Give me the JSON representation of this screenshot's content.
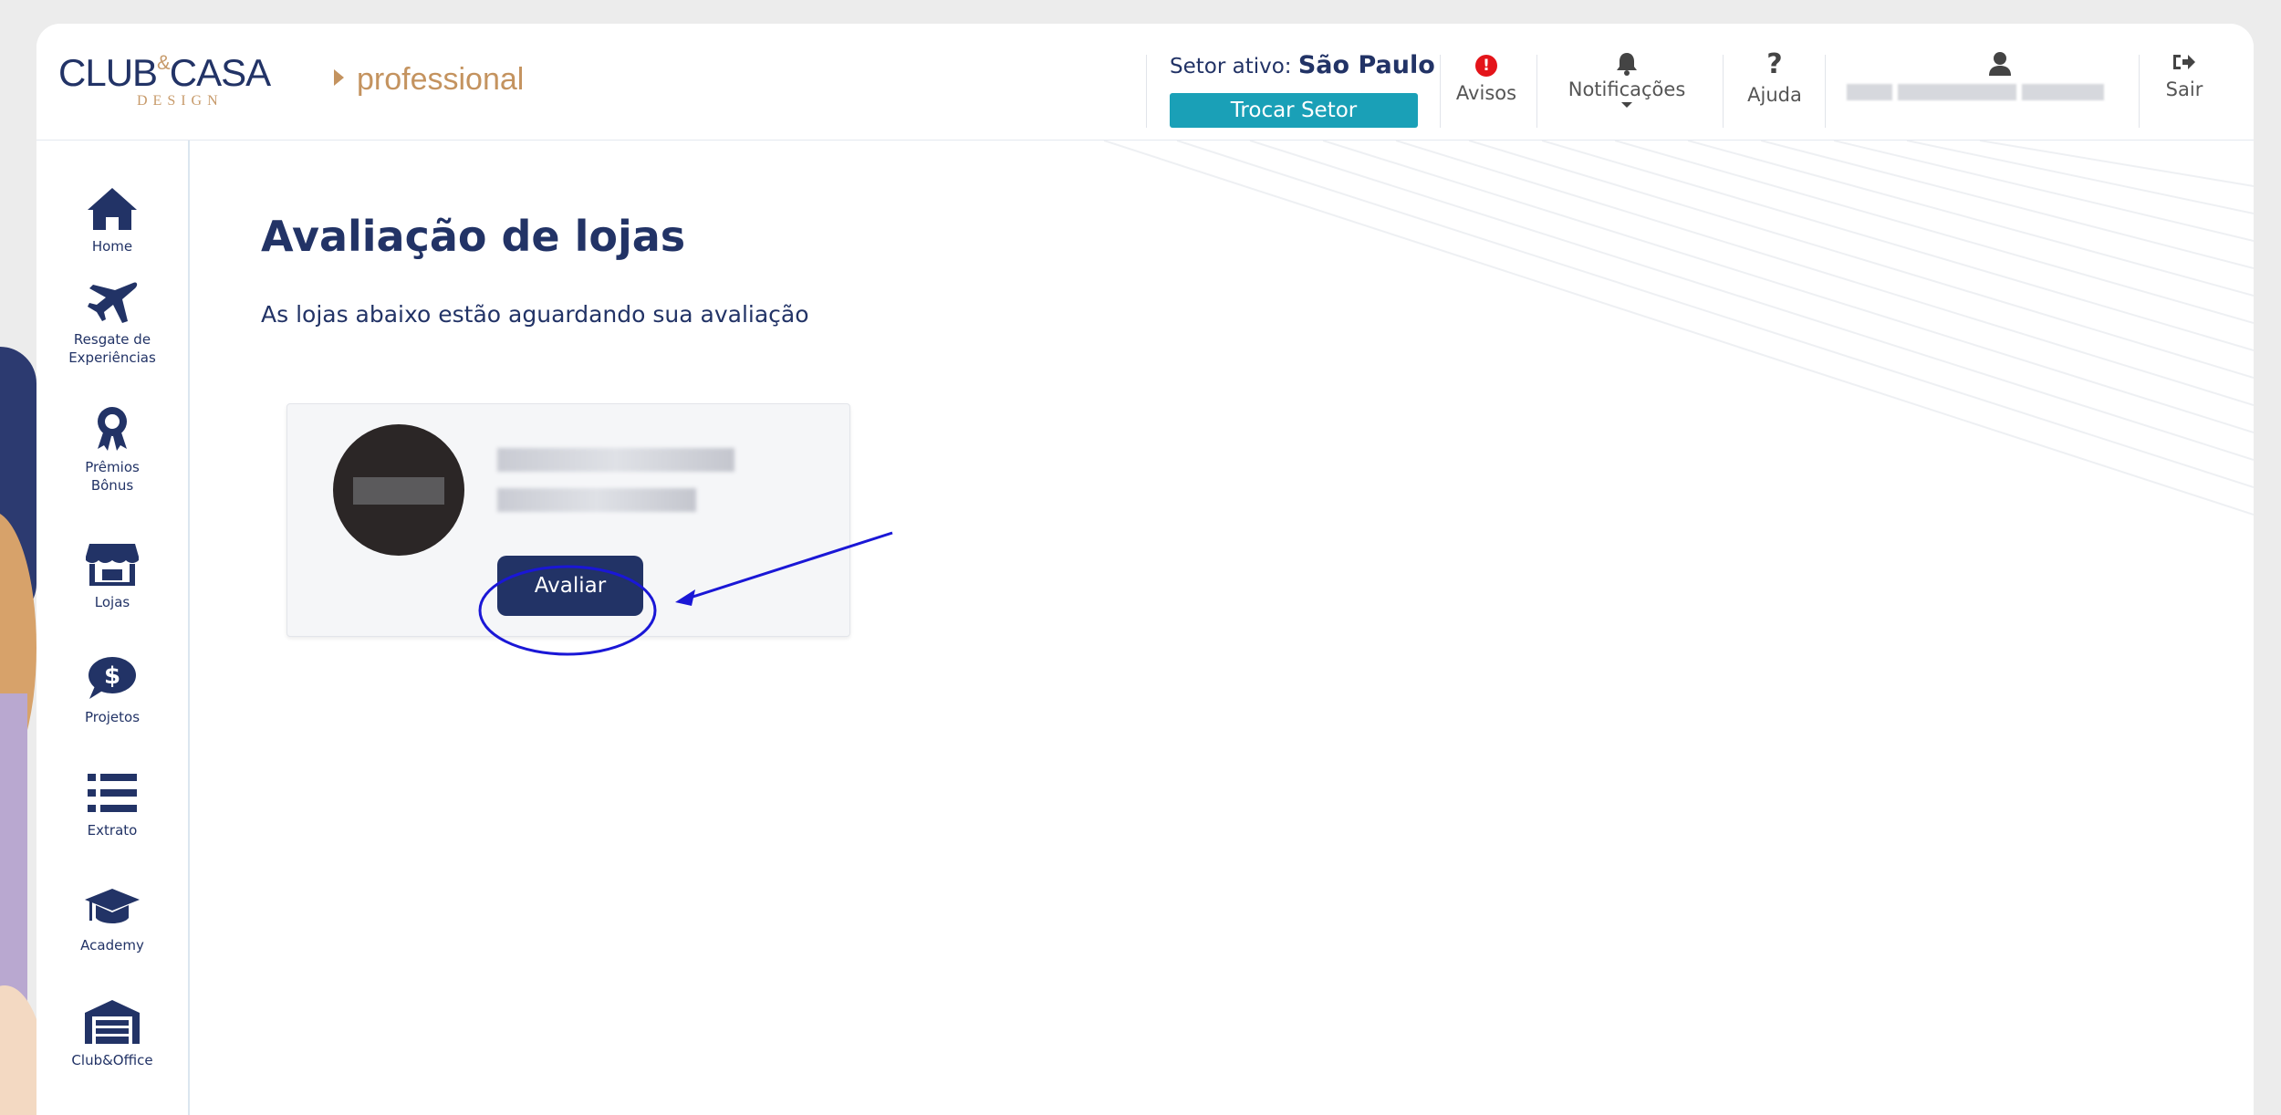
{
  "header": {
    "logo": {
      "main": "CLUB",
      "amp": "&",
      "main2": "CASA",
      "sub": "DESIGN"
    },
    "edition": "professional",
    "sector_label": "Setor ativo:",
    "sector_value": "São Paulo",
    "change_sector_label": "Trocar Setor",
    "alerts_label": "Avisos",
    "alerts_badge": "!",
    "notifications_label": "Notificações",
    "help_label": "Ajuda",
    "logout_label": "Sair"
  },
  "sidebar": {
    "items": [
      {
        "label": "Home",
        "icon": "home-icon"
      },
      {
        "label": "Resgate de Experiências",
        "icon": "airplane-icon"
      },
      {
        "label": "Prêmios Bônus",
        "icon": "award-ribbon-icon"
      },
      {
        "label": "Lojas",
        "icon": "store-icon"
      },
      {
        "label": "Projetos",
        "icon": "dollar-chat-icon"
      },
      {
        "label": "Extrato",
        "icon": "list-icon"
      },
      {
        "label": "Academy",
        "icon": "graduation-cap-icon"
      },
      {
        "label": "Club&Office",
        "icon": "warehouse-icon"
      }
    ]
  },
  "main": {
    "title": "Avaliação de lojas",
    "subtitle": "As lojas abaixo estão aguardando sua avaliação",
    "store_card": {
      "button_label": "Avaliar"
    }
  },
  "colors": {
    "brand_navy": "#223366",
    "brand_gold": "#c4935f",
    "teal": "#1aa0b7",
    "alert_red": "#e4141a",
    "annotation_blue": "#1a17d6"
  }
}
